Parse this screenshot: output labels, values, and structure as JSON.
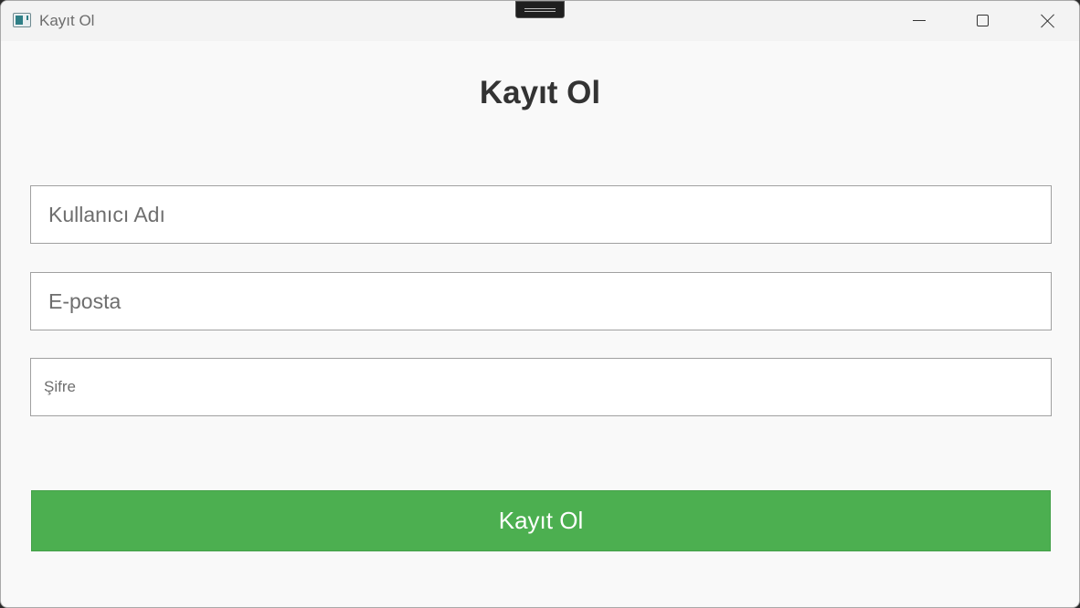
{
  "window": {
    "title": "Kayıt Ol",
    "controls": {
      "minimize": "minimize",
      "maximize": "maximize",
      "close": "close"
    }
  },
  "form": {
    "heading": "Kayıt Ol",
    "fields": {
      "username": {
        "placeholder": "Kullanıcı Adı",
        "value": ""
      },
      "email": {
        "placeholder": "E-posta",
        "value": ""
      },
      "password": {
        "placeholder": "Şifre",
        "value": ""
      }
    },
    "submit_label": "Kayıt Ol"
  },
  "colors": {
    "accent": "#4caf50",
    "window_bg": "#f9f9f9",
    "titlebar_bg": "#f3f3f3"
  },
  "icons": {
    "app": "app-window-icon",
    "minimize": "minimize-icon",
    "maximize": "maximize-icon",
    "close": "close-icon"
  }
}
